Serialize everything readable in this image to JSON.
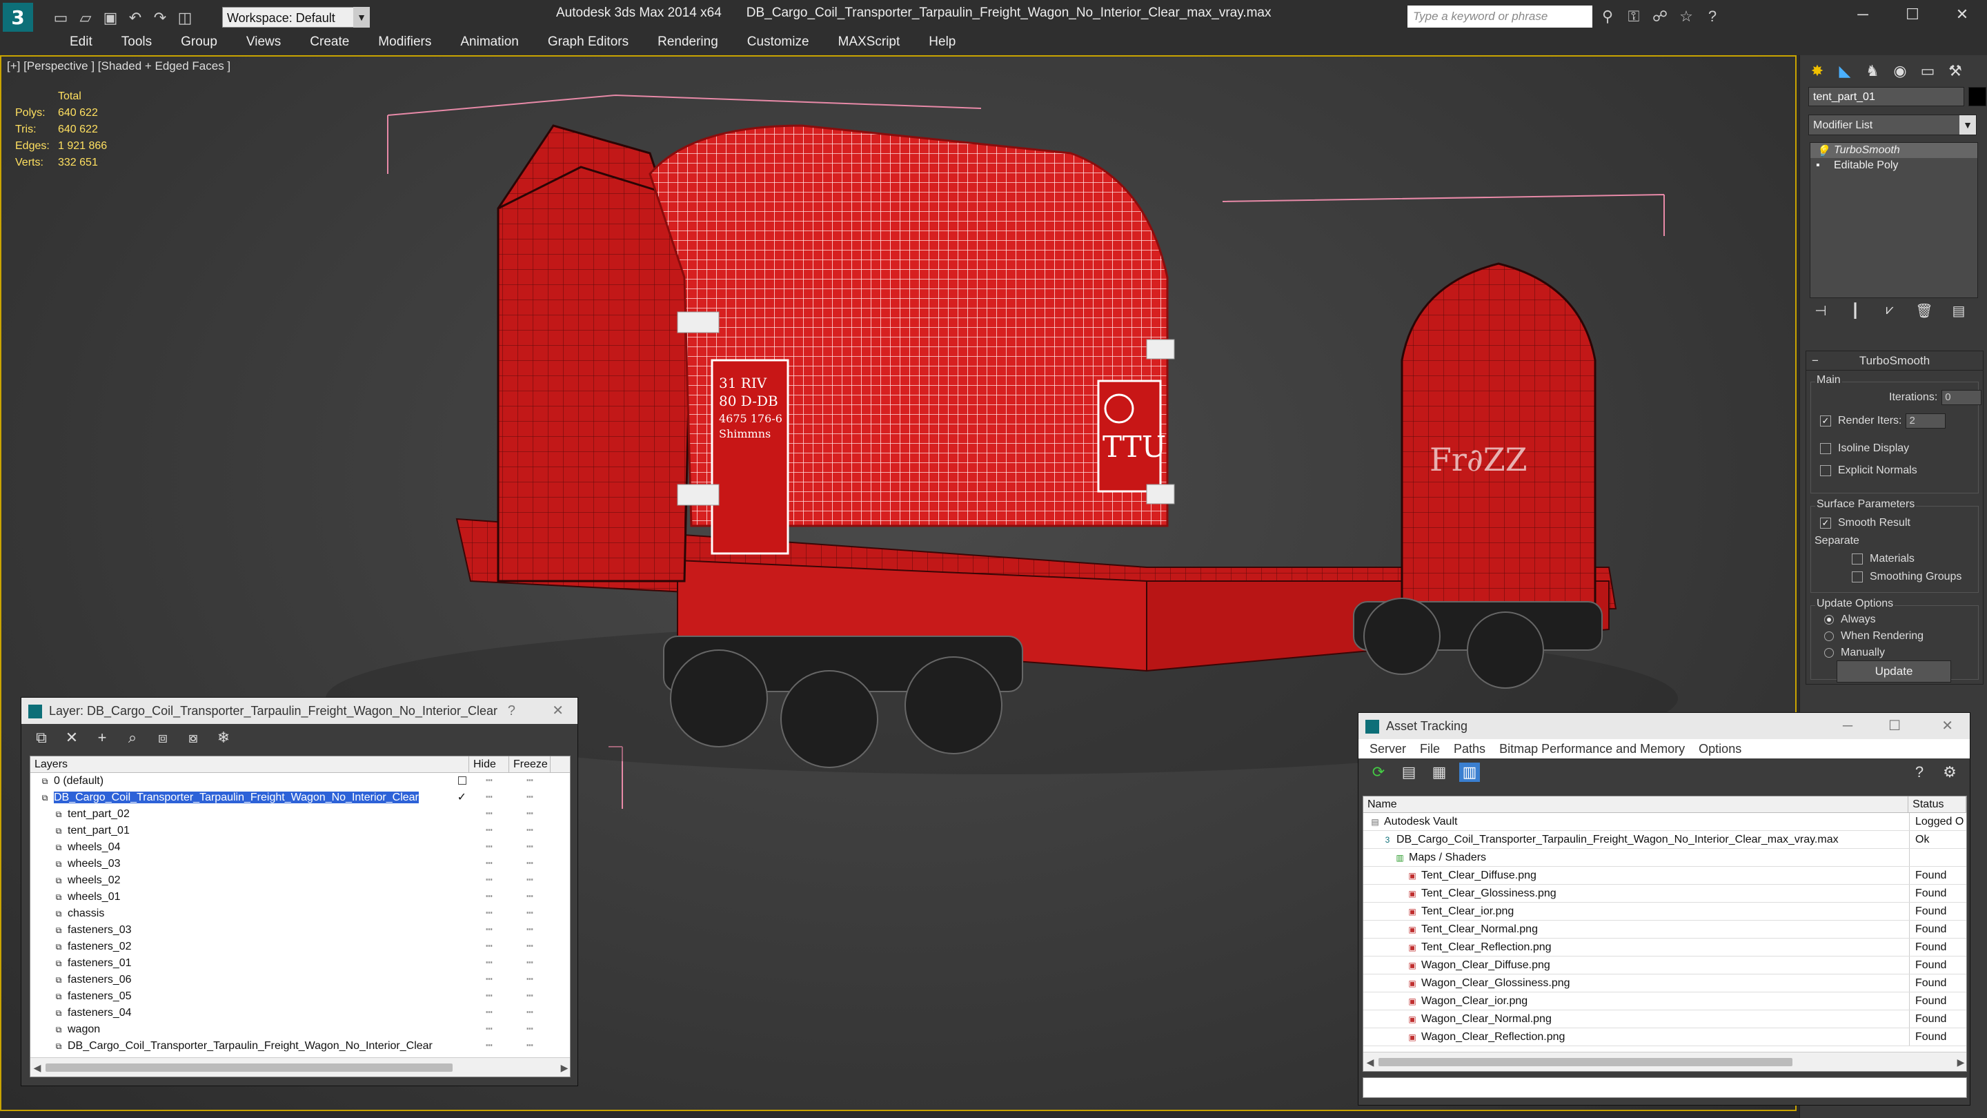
{
  "app": {
    "name": "Autodesk 3ds Max 2014 x64",
    "file": "DB_Cargo_Coil_Transporter_Tarpaulin_Freight_Wagon_No_Interior_Clear_max_vray.max",
    "workspace": "Workspace: Default",
    "search_placeholder": "Type a keyword or phrase"
  },
  "menu": [
    "Edit",
    "Tools",
    "Group",
    "Views",
    "Create",
    "Modifiers",
    "Animation",
    "Graph Editors",
    "Rendering",
    "Customize",
    "MAXScript",
    "Help"
  ],
  "viewport": {
    "label": "[+] [Perspective ] [Shaded + Edged Faces ]",
    "stats": {
      "header": "Total",
      "rows": [
        {
          "k": "Polys:",
          "v": "640 622"
        },
        {
          "k": "Tris:",
          "v": "640 622"
        },
        {
          "k": "Edges:",
          "v": "1 921 866"
        },
        {
          "k": "Verts:",
          "v": "332 651"
        }
      ]
    },
    "decal_left": [
      "31 RIV",
      "80 D-DB",
      "4675 176-6",
      "Shimmns"
    ],
    "decal_right": "TTU",
    "decal_side": "Fr∂ZZ"
  },
  "command_panel": {
    "object_name": "tent_part_01",
    "modifier_list": "Modifier List",
    "stack": [
      "TurboSmooth",
      "Editable Poly"
    ],
    "rollout_title": "TurboSmooth",
    "main_label": "Main",
    "iterations_label": "Iterations:",
    "iterations": "0",
    "render_iters_label": "Render Iters:",
    "render_iters": "2",
    "isoline": "Isoline Display",
    "explicit_normals": "Explicit Normals",
    "surface_params": "Surface Parameters",
    "smooth_result": "Smooth Result",
    "separate": "Separate",
    "materials": "Materials",
    "smoothing_groups": "Smoothing Groups",
    "update_options": "Update Options",
    "always": "Always",
    "when_rendering": "When Rendering",
    "manually": "Manually",
    "update_btn": "Update"
  },
  "layer_window": {
    "title": "Layer: DB_Cargo_Coil_Transporter_Tarpaulin_Freight_Wagon_No_Interior_Clear",
    "help": "?",
    "close": "✕",
    "cols": [
      "Layers",
      "Hide",
      "Freeze"
    ],
    "rows": [
      {
        "name": "0 (default)",
        "indent": 1
      },
      {
        "name": "DB_Cargo_Coil_Transporter_Tarpaulin_Freight_Wagon_No_Interior_Clear",
        "indent": 1,
        "sel": true
      },
      {
        "name": "tent_part_02",
        "indent": 2
      },
      {
        "name": "tent_part_01",
        "indent": 2
      },
      {
        "name": "wheels_04",
        "indent": 2
      },
      {
        "name": "wheels_03",
        "indent": 2
      },
      {
        "name": "wheels_02",
        "indent": 2
      },
      {
        "name": "wheels_01",
        "indent": 2
      },
      {
        "name": "chassis",
        "indent": 2
      },
      {
        "name": "fasteners_03",
        "indent": 2
      },
      {
        "name": "fasteners_02",
        "indent": 2
      },
      {
        "name": "fasteners_01",
        "indent": 2
      },
      {
        "name": "fasteners_06",
        "indent": 2
      },
      {
        "name": "fasteners_05",
        "indent": 2
      },
      {
        "name": "fasteners_04",
        "indent": 2
      },
      {
        "name": "wagon",
        "indent": 2
      },
      {
        "name": "DB_Cargo_Coil_Transporter_Tarpaulin_Freight_Wagon_No_Interior_Clear",
        "indent": 2
      }
    ]
  },
  "asset_window": {
    "title": "Asset Tracking",
    "menu": [
      "Server",
      "File",
      "Paths",
      "Bitmap Performance and Memory",
      "Options"
    ],
    "cols": [
      "Name",
      "Status"
    ],
    "rows": [
      {
        "name": "Autodesk Vault",
        "status": "Logged O",
        "indent": 1
      },
      {
        "name": "DB_Cargo_Coil_Transporter_Tarpaulin_Freight_Wagon_No_Interior_Clear_max_vray.max",
        "status": "Ok",
        "indent": 2
      },
      {
        "name": "Maps / Shaders",
        "status": "",
        "indent": 3
      },
      {
        "name": "Tent_Clear_Diffuse.png",
        "status": "Found",
        "indent": 4
      },
      {
        "name": "Tent_Clear_Glossiness.png",
        "status": "Found",
        "indent": 4
      },
      {
        "name": "Tent_Clear_ior.png",
        "status": "Found",
        "indent": 4
      },
      {
        "name": "Tent_Clear_Normal.png",
        "status": "Found",
        "indent": 4
      },
      {
        "name": "Tent_Clear_Reflection.png",
        "status": "Found",
        "indent": 4
      },
      {
        "name": "Wagon_Clear_Diffuse.png",
        "status": "Found",
        "indent": 4
      },
      {
        "name": "Wagon_Clear_Glossiness.png",
        "status": "Found",
        "indent": 4
      },
      {
        "name": "Wagon_Clear_ior.png",
        "status": "Found",
        "indent": 4
      },
      {
        "name": "Wagon_Clear_Normal.png",
        "status": "Found",
        "indent": 4
      },
      {
        "name": "Wagon_Clear_Reflection.png",
        "status": "Found",
        "indent": 4
      }
    ]
  }
}
